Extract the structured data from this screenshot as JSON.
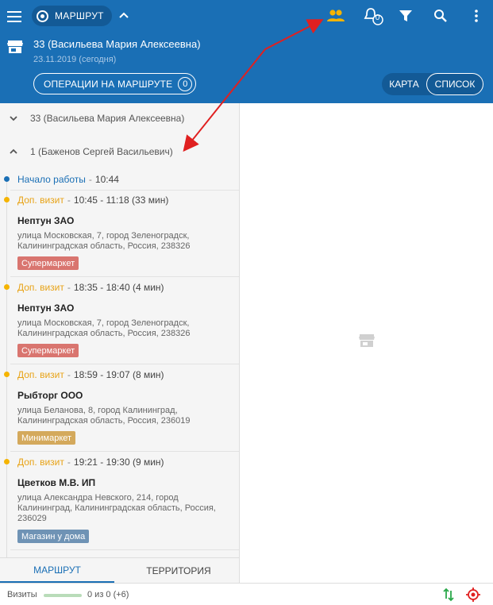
{
  "header": {
    "route_label": "МАРШРУТ",
    "agent_name": "33 (Васильева Мария Алексеевна)",
    "date": "23.11.2019 (сегодня)",
    "ops_button_label": "ОПЕРАЦИИ НА МАРШРУТЕ",
    "ops_count": "0",
    "notifications_count": "0",
    "view_toggle": {
      "map": "КАРТА",
      "list": "СПИСОК",
      "selected": "СПИСОК"
    },
    "icons": [
      "menu-icon",
      "route-icon",
      "chevron-up-icon",
      "people-icon",
      "bell-icon",
      "filter-icon",
      "search-icon",
      "more-vert-icon",
      "store-icon"
    ],
    "accent_color": "#1a6fb5",
    "people_icon_color": "#f5b400"
  },
  "groups": [
    {
      "label": "33 (Васильева Мария Алексеевна)",
      "expanded": false
    },
    {
      "label": "1 (Баженов Сергей Васильевич)",
      "expanded": true
    }
  ],
  "start": {
    "type": "Начало работы",
    "time": "10:44"
  },
  "visits": [
    {
      "type": "Доп. визит",
      "time": "10:45 - 11:18 (33 мин)",
      "name": "Нептун ЗАО",
      "address": "улица Московская, 7, город Зеленоградск, Калининградская область, Россия, 238326",
      "tag": "Супермаркет",
      "tag_color": "#d9756f"
    },
    {
      "type": "Доп. визит",
      "time": "18:35 - 18:40 (4 мин)",
      "name": "Нептун ЗАО",
      "address": "улица Московская, 7, город Зеленоградск, Калининградская область, Россия, 238326",
      "tag": "Супермаркет",
      "tag_color": "#d9756f"
    },
    {
      "type": "Доп. визит",
      "time": "18:59 - 19:07 (8 мин)",
      "name": "Рыбторг ООО",
      "address": "улица Беланова, 8, город Калининград, Калининградская область, Россия, 236019",
      "tag": "Минимаркет",
      "tag_color": "#d4a95c"
    },
    {
      "type": "Доп. визит",
      "time": "19:21 - 19:30 (9 мин)",
      "name": "Цветков М.В. ИП",
      "address": "улица Александра Невского, 214, город Калининград, Калининградская область, Россия, 236029",
      "tag": "Магазин у дома",
      "tag_color": "#6f93b5"
    }
  ],
  "tabs": {
    "route": "МАРШРУТ",
    "territory": "ТЕРРИТОРИЯ",
    "active": "МАРШРУТ"
  },
  "footer": {
    "visits_label": "Визиты",
    "visits_count": "0 из 0 (+6)",
    "icons": [
      "sort-icon",
      "locate-icon"
    ]
  },
  "annotation_color": "#e02020"
}
